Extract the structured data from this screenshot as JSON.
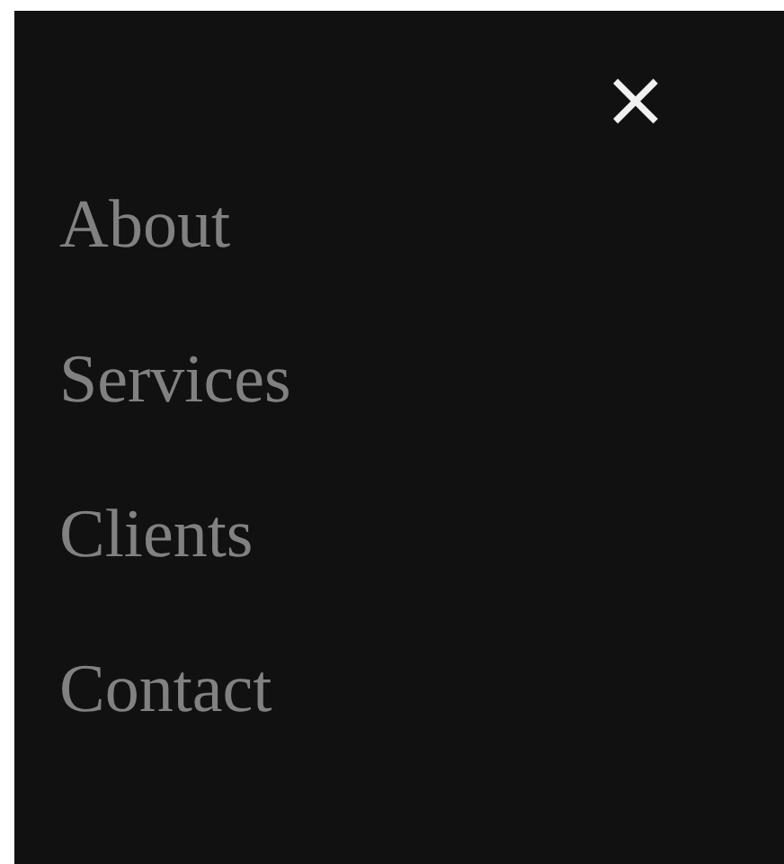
{
  "close_button": {
    "label": "×"
  },
  "menu": {
    "items": [
      {
        "label": "About"
      },
      {
        "label": "Services"
      },
      {
        "label": "Clients"
      },
      {
        "label": "Contact"
      }
    ]
  }
}
